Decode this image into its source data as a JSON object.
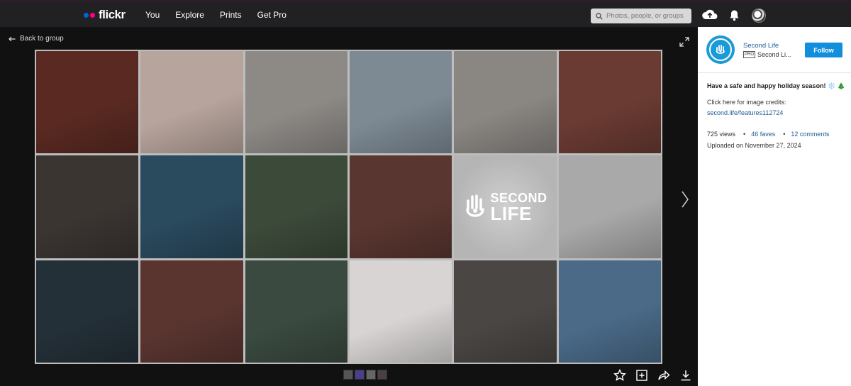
{
  "topbar": {
    "logo": "flickr",
    "nav": [
      "You",
      "Explore",
      "Prints",
      "Get Pro"
    ],
    "search_placeholder": "Photos, people, or groups"
  },
  "viewer": {
    "back_label": "Back to group",
    "tiles": [
      "#5a2a22",
      "#b7a49c",
      "#8d8a86",
      "#7d8a94",
      "#8a8682",
      "#6a3b33",
      "#3b3532",
      "#2a4a5e",
      "#3c4a3a",
      "#5a3630",
      "#bcbcbc",
      "#a9a9a9",
      "#243038",
      "#5a3530",
      "#3a4a40",
      "#d8d4d4",
      "#4a4644",
      "#4a6a88"
    ],
    "sl_tile_index": 10,
    "sl_logo_words": [
      "SECOND",
      "LIFE"
    ],
    "thumbs": [
      "#555",
      "#4a3f8a",
      "#666",
      "#4a4040"
    ]
  },
  "side": {
    "owner_name": "Second Life",
    "pro_badge": "PRO",
    "owner_sub": "Second Li...",
    "follow_label": "Follow",
    "desc_title": "Have a safe and happy holiday season! ❄️ 🎄",
    "desc_line": "Click here for image credits:",
    "desc_link": "second.life/features112724",
    "views": "725 views",
    "faves": "46 faves",
    "comments": "12 comments",
    "uploaded": "Uploaded on November 27, 2024"
  },
  "colors": {
    "accent": "#128fdc",
    "link": "#1c5b94",
    "brand_blue": "#0063dc",
    "brand_pink": "#ff0084"
  }
}
